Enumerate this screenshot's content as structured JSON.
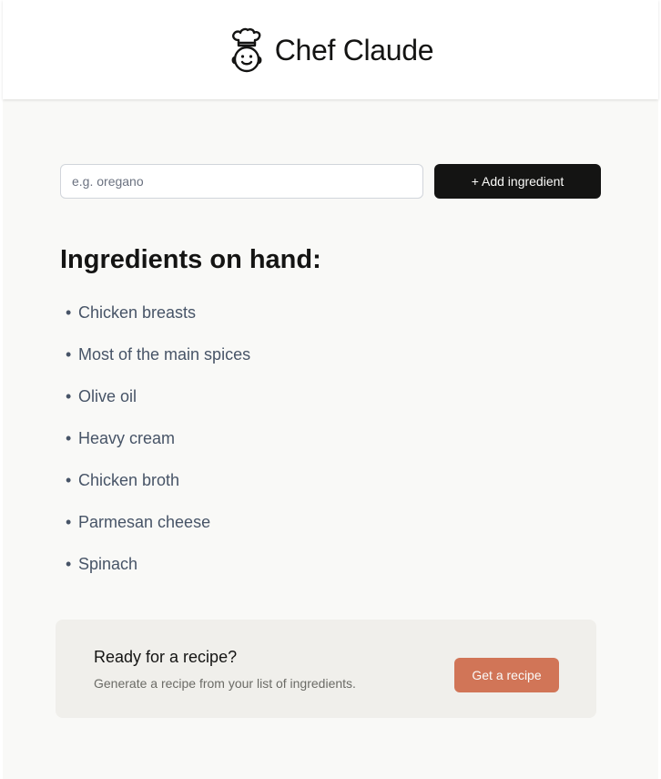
{
  "header": {
    "logo_icon": "chef-face-icon",
    "title": "Chef Claude"
  },
  "form": {
    "input_placeholder": "e.g. oregano",
    "input_value": "",
    "add_button_label": "+ Add ingredient"
  },
  "ingredients": {
    "title": "Ingredients on hand:",
    "bullet": "•",
    "items": [
      "Chicken breasts",
      "Most of the main spices",
      "Olive oil",
      "Heavy cream",
      "Chicken broth",
      "Parmesan cheese",
      "Spinach"
    ]
  },
  "cta": {
    "title": "Ready for a recipe?",
    "subtitle": "Generate a recipe from your list of ingredients.",
    "button_label": "Get a recipe"
  },
  "colors": {
    "page_background": "#f9f9f7",
    "header_background": "#ffffff",
    "primary_button": "#141413",
    "accent_button": "#d17557",
    "cta_background": "#f0efeb",
    "list_text": "#475467"
  }
}
